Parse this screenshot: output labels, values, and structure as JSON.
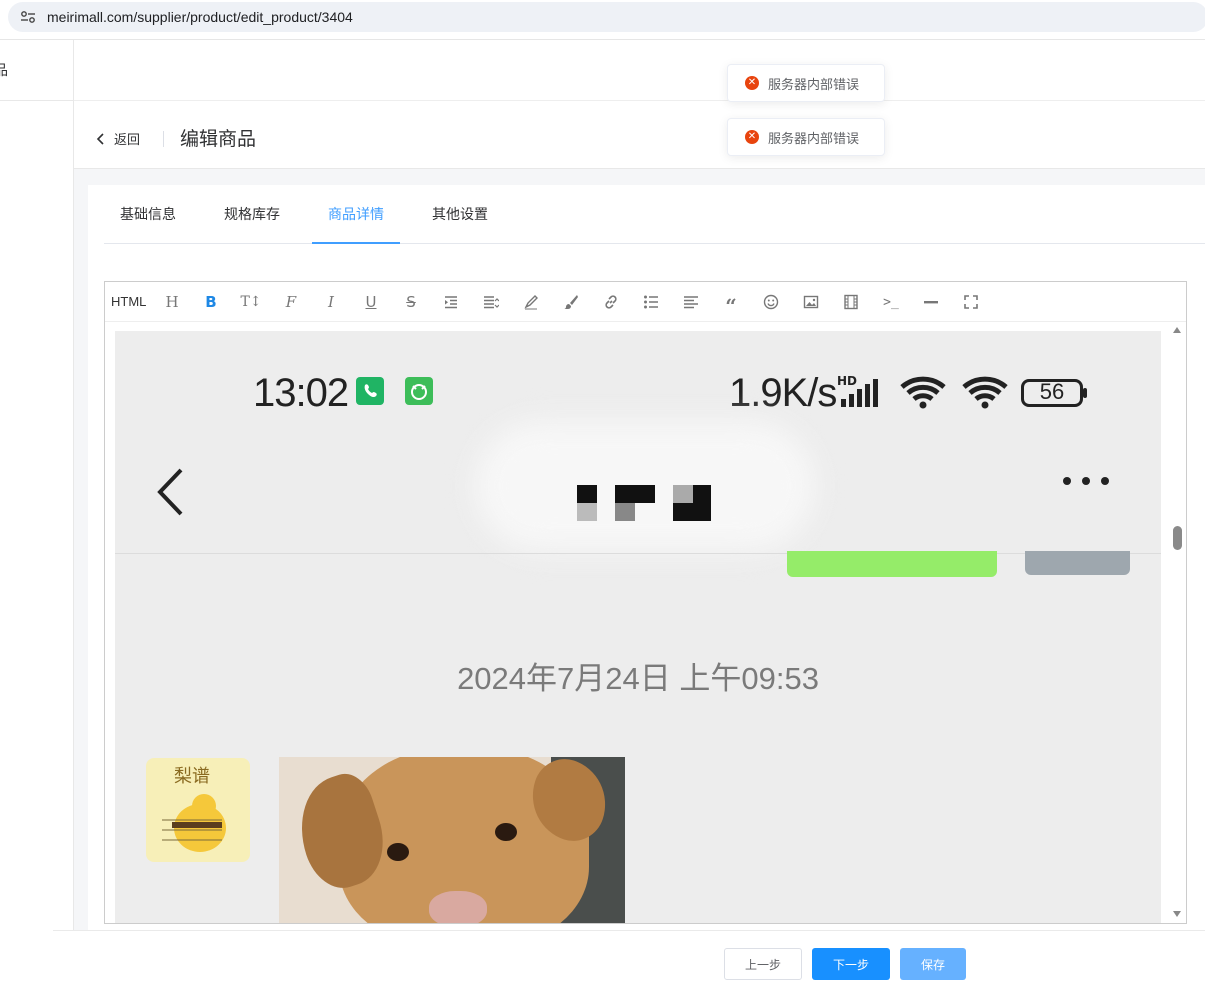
{
  "browser": {
    "url": "meirimall.com/supplier/product/edit_product/3404"
  },
  "sidebar": {
    "item_label": "品"
  },
  "header": {
    "back_label": "返回",
    "title": "编辑商品"
  },
  "toasts": [
    {
      "message": "服务器内部错误"
    },
    {
      "message": "服务器内部错误"
    }
  ],
  "tabs": [
    {
      "label": "基础信息",
      "active": false
    },
    {
      "label": "规格库存",
      "active": false
    },
    {
      "label": "商品详情",
      "active": true
    },
    {
      "label": "其他设置",
      "active": false
    }
  ],
  "editor": {
    "toolbar": {
      "html_label": "HTML",
      "tools": [
        "heading-icon",
        "bold-icon",
        "font-size-icon",
        "font-family-icon",
        "italic-icon",
        "underline-icon",
        "strikethrough-icon",
        "indent-icon",
        "line-height-icon",
        "font-color-icon",
        "background-color-icon",
        "link-icon",
        "list-icon",
        "justify-icon",
        "quote-icon",
        "emoticon-icon",
        "image-icon",
        "video-icon",
        "code-icon",
        "divider-icon",
        "fullscreen-icon"
      ]
    },
    "content_image": {
      "status_time": "13:02",
      "network_speed": "1.9K/s",
      "network_badge": "HD",
      "battery": "56",
      "chat_timestamp": "2024年7月24日 上午09:53",
      "avatar_text": "梨谱"
    }
  },
  "footer": {
    "prev_label": "上一步",
    "next_label": "下一步",
    "save_label": "保存"
  },
  "colors": {
    "primary": "#1890ff",
    "active_tab": "#409eff",
    "error": "#e8440e"
  }
}
